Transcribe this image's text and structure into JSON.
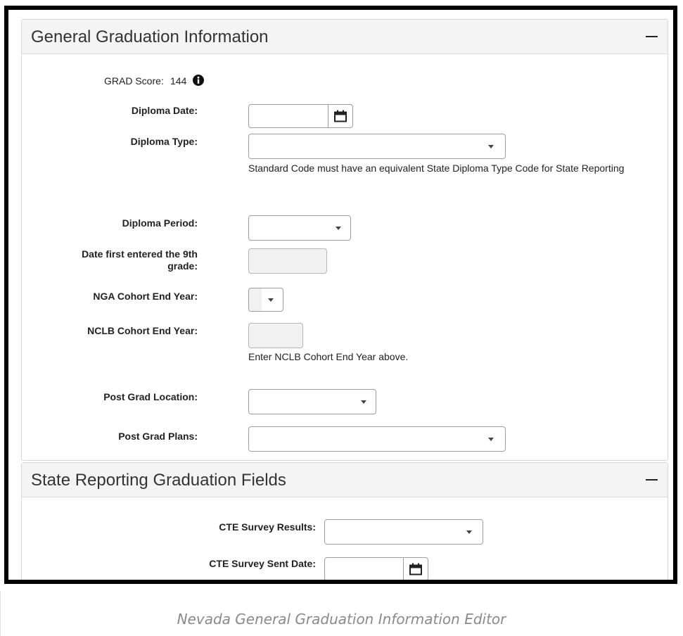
{
  "general": {
    "title": "General Graduation Information",
    "grad_score_label": "GRAD Score:",
    "grad_score_value": "144",
    "diploma_date_label": "Diploma Date:",
    "diploma_date_value": "",
    "diploma_type_label": "Diploma Type:",
    "diploma_type_value": "",
    "diploma_type_help": "Standard Code must have an equivalent State Diploma Type Code for State Reporting",
    "diploma_period_label": "Diploma Period:",
    "diploma_period_value": "",
    "first_9th_label_line1": "Date first entered the 9th",
    "first_9th_label_line2": "grade:",
    "first_9th_value": "",
    "nga_label": "NGA Cohort End Year:",
    "nga_value": "",
    "nclb_label": "NCLB Cohort End Year:",
    "nclb_value": "",
    "nclb_help": "Enter NCLB Cohort End Year above.",
    "post_grad_location_label": "Post Grad Location:",
    "post_grad_location_value": "",
    "post_grad_plans_label": "Post Grad Plans:",
    "post_grad_plans_value": ""
  },
  "state": {
    "title": "State Reporting Graduation Fields",
    "cte_results_label": "CTE Survey Results:",
    "cte_results_value": "",
    "cte_sent_label": "CTE Survey Sent Date:",
    "cte_sent_value": ""
  },
  "caption": "Nevada General Graduation Information Editor",
  "icons": {
    "info": "info-icon",
    "calendar": "calendar-icon",
    "dropdown": "chevron-down-icon",
    "collapse": "minus-icon"
  }
}
